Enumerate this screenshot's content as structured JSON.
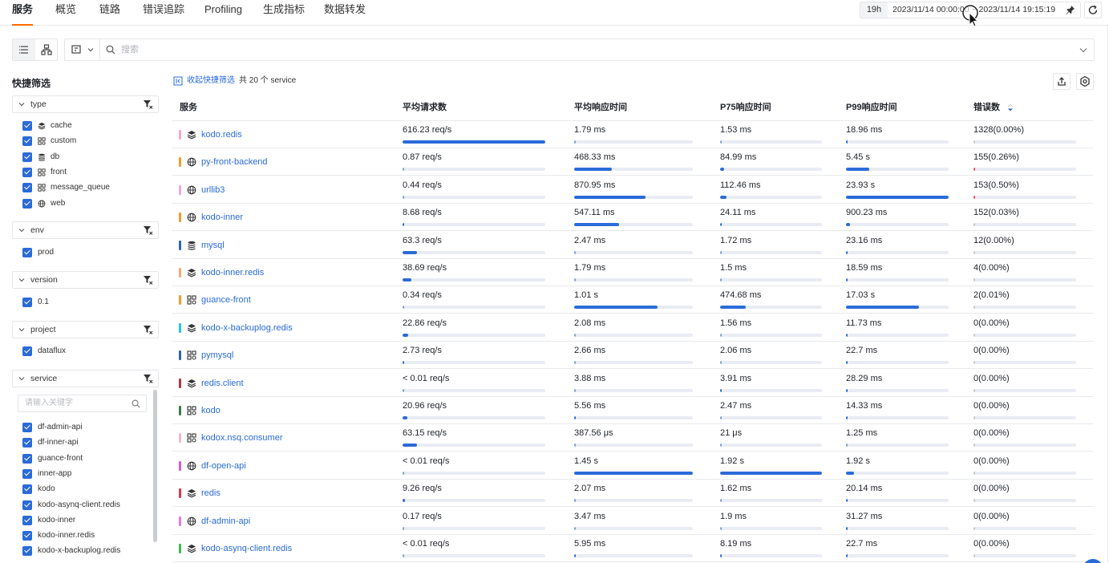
{
  "nav": {
    "tabs": [
      "服务",
      "概览",
      "链路",
      "错误追踪",
      "Profiling",
      "生成指标",
      "数据转发"
    ],
    "active_index": 0,
    "time_badge": "19h",
    "time_range": "2023/11/14 00:00:00 ~ 2023/11/14 19:15:19"
  },
  "search": {
    "placeholder": "搜索"
  },
  "sidebar": {
    "title": "快捷筛选",
    "groups": [
      {
        "label": "type",
        "items": [
          {
            "label": "cache",
            "icon": "cache-icon"
          },
          {
            "label": "custom",
            "icon": "custom-icon"
          },
          {
            "label": "db",
            "icon": "db-icon"
          },
          {
            "label": "front",
            "icon": "front-icon"
          },
          {
            "label": "message_queue",
            "icon": "message-queue-icon"
          },
          {
            "label": "web",
            "icon": "web-icon"
          }
        ]
      },
      {
        "label": "env",
        "items": [
          {
            "label": "prod"
          }
        ]
      },
      {
        "label": "version",
        "items": [
          {
            "label": "0.1"
          }
        ]
      },
      {
        "label": "project",
        "items": [
          {
            "label": "dataflux"
          }
        ]
      },
      {
        "label": "service",
        "search_placeholder": "请输入关键字",
        "items": [
          {
            "label": "df-admin-api"
          },
          {
            "label": "df-inner-api"
          },
          {
            "label": "guance-front"
          },
          {
            "label": "inner-app"
          },
          {
            "label": "kodo"
          },
          {
            "label": "kodo-asynq-client.redis"
          },
          {
            "label": "kodo-inner"
          },
          {
            "label": "kodo-inner.redis"
          },
          {
            "label": "kodo-x-backuplog.redis"
          }
        ]
      }
    ]
  },
  "main": {
    "collapse_label": "收起快捷筛选",
    "total_label": "共 20 个 service",
    "columns": [
      "服务",
      "平均请求数",
      "平均响应时间",
      "P75响应时间",
      "P99响应时间",
      "错误数"
    ]
  },
  "colors": {
    "accent": "#2a6bd8",
    "active_tab_underline": "#ff6a00",
    "error_bar": "#f5455c"
  },
  "rows": [
    {
      "name": "kodo.redis",
      "icon": "cache-icon",
      "color": "#f7a8c8",
      "req": "616.23 req/s",
      "req_pct": 1.0,
      "avg": "1.79 ms",
      "avg_pct": 0.002,
      "p75": "1.53 ms",
      "p75_pct": 0.003,
      "p99": "18.96 ms",
      "p99_pct": 0.008,
      "err": "1328(0.00%)",
      "err_pct": 0.0
    },
    {
      "name": "py-front-backend",
      "icon": "web-icon",
      "color": "#f79a2b",
      "req": "0.87 req/s",
      "req_pct": 0.001,
      "avg": "468.33 ms",
      "avg_pct": 0.32,
      "p75": "84.99 ms",
      "p75_pct": 0.04,
      "p99": "5.45 s",
      "p99_pct": 0.23,
      "err": "155(0.26%)",
      "err_pct": 0.005
    },
    {
      "name": "urllib3",
      "icon": "web-icon",
      "color": "#f1a8d8",
      "req": "0.44 req/s",
      "req_pct": 0.001,
      "avg": "870.95 ms",
      "avg_pct": 0.6,
      "p75": "112.46 ms",
      "p75_pct": 0.06,
      "p99": "23.93 s",
      "p99_pct": 1.0,
      "err": "153(0.50%)",
      "err_pct": 0.005
    },
    {
      "name": "kodo-inner",
      "icon": "web-icon",
      "color": "#f79a2b",
      "req": "8.68 req/s",
      "req_pct": 0.014,
      "avg": "547.11 ms",
      "avg_pct": 0.38,
      "p75": "24.11 ms",
      "p75_pct": 0.013,
      "p99": "900.23 ms",
      "p99_pct": 0.04,
      "err": "152(0.03%)",
      "err_pct": 0.0
    },
    {
      "name": "mysql",
      "icon": "db-icon",
      "color": "#2b66b8",
      "req": "63.3 req/s",
      "req_pct": 0.1,
      "avg": "2.47 ms",
      "avg_pct": 0.002,
      "p75": "1.72 ms",
      "p75_pct": 0.003,
      "p99": "23.16 ms",
      "p99_pct": 0.008,
      "err": "12(0.00%)",
      "err_pct": 0.0
    },
    {
      "name": "kodo-inner.redis",
      "icon": "cache-icon",
      "color": "#f7a87c",
      "req": "38.69 req/s",
      "req_pct": 0.063,
      "avg": "1.79 ms",
      "avg_pct": 0.002,
      "p75": "1.5 ms",
      "p75_pct": 0.003,
      "p99": "18.59 ms",
      "p99_pct": 0.008,
      "err": "4(0.00%)",
      "err_pct": 0.0
    },
    {
      "name": "guance-front",
      "icon": "custom-icon",
      "color": "#f79a2b",
      "req": "0.34 req/s",
      "req_pct": 0.001,
      "avg": "1.01 s",
      "avg_pct": 0.7,
      "p75": "474.68 ms",
      "p75_pct": 0.25,
      "p99": "17.03 s",
      "p99_pct": 0.71,
      "err": "2(0.01%)",
      "err_pct": 0.0
    },
    {
      "name": "kodo-x-backuplog.redis",
      "icon": "cache-icon",
      "color": "#29c4e0",
      "req": "22.86 req/s",
      "req_pct": 0.037,
      "avg": "2.08 ms",
      "avg_pct": 0.002,
      "p75": "1.56 ms",
      "p75_pct": 0.003,
      "p99": "11.73 ms",
      "p99_pct": 0.006,
      "err": "0(0.00%)",
      "err_pct": 0.0
    },
    {
      "name": "pymysql",
      "icon": "custom-icon",
      "color": "#2b66b8",
      "req": "2.73 req/s",
      "req_pct": 0.004,
      "avg": "2.66 ms",
      "avg_pct": 0.002,
      "p75": "2.06 ms",
      "p75_pct": 0.003,
      "p99": "22.7 ms",
      "p99_pct": 0.008,
      "err": "0(0.00%)",
      "err_pct": 0.0
    },
    {
      "name": "redis.client",
      "icon": "cache-icon",
      "color": "#c0313f",
      "req": "< 0.01 req/s",
      "req_pct": 0.0,
      "avg": "3.88 ms",
      "avg_pct": 0.003,
      "p75": "3.91 ms",
      "p75_pct": 0.004,
      "p99": "28.29 ms",
      "p99_pct": 0.008,
      "err": "0(0.00%)",
      "err_pct": 0.0
    },
    {
      "name": "kodo",
      "icon": "custom-icon",
      "color": "#3f7a4c",
      "req": "20.96 req/s",
      "req_pct": 0.034,
      "avg": "5.56 ms",
      "avg_pct": 0.004,
      "p75": "2.47 ms",
      "p75_pct": 0.003,
      "p99": "14.33 ms",
      "p99_pct": 0.006,
      "err": "0(0.00%)",
      "err_pct": 0.0
    },
    {
      "name": "kodox.nsq.consumer",
      "icon": "custom-icon",
      "color": "#f7b8c8",
      "req": "63.15 req/s",
      "req_pct": 0.1,
      "avg": "387.56 μs",
      "avg_pct": 0.001,
      "p75": "21 μs",
      "p75_pct": 0.001,
      "p99": "1.25 ms",
      "p99_pct": 0.001,
      "err": "0(0.00%)",
      "err_pct": 0.0
    },
    {
      "name": "df-open-api",
      "icon": "web-icon",
      "color": "#d65ad8",
      "req": "< 0.01 req/s",
      "req_pct": 0.0,
      "avg": "1.45 s",
      "avg_pct": 1.0,
      "p75": "1.92 s",
      "p75_pct": 1.0,
      "p99": "1.92 s",
      "p99_pct": 0.08,
      "err": "0(0.00%)",
      "err_pct": 0.0
    },
    {
      "name": "redis",
      "icon": "cache-icon",
      "color": "#d63a52",
      "req": "9.26 req/s",
      "req_pct": 0.015,
      "avg": "2.07 ms",
      "avg_pct": 0.002,
      "p75": "1.62 ms",
      "p75_pct": 0.003,
      "p99": "20.14 ms",
      "p99_pct": 0.008,
      "err": "0(0.00%)",
      "err_pct": 0.0
    },
    {
      "name": "df-admin-api",
      "icon": "web-icon",
      "color": "#e67ad8",
      "req": "0.17 req/s",
      "req_pct": 0.0,
      "avg": "3.47 ms",
      "avg_pct": 0.003,
      "p75": "1.9 ms",
      "p75_pct": 0.003,
      "p99": "31.27 ms",
      "p99_pct": 0.008,
      "err": "0(0.00%)",
      "err_pct": 0.0
    },
    {
      "name": "kodo-asynq-client.redis",
      "icon": "cache-icon",
      "color": "#3fb950",
      "req": "< 0.01 req/s",
      "req_pct": 0.0,
      "avg": "5.95 ms",
      "avg_pct": 0.004,
      "p75": "8.19 ms",
      "p75_pct": 0.006,
      "p99": "22.7 ms",
      "p99_pct": 0.008,
      "err": "0(0.00%)",
      "err_pct": 0.0
    }
  ]
}
